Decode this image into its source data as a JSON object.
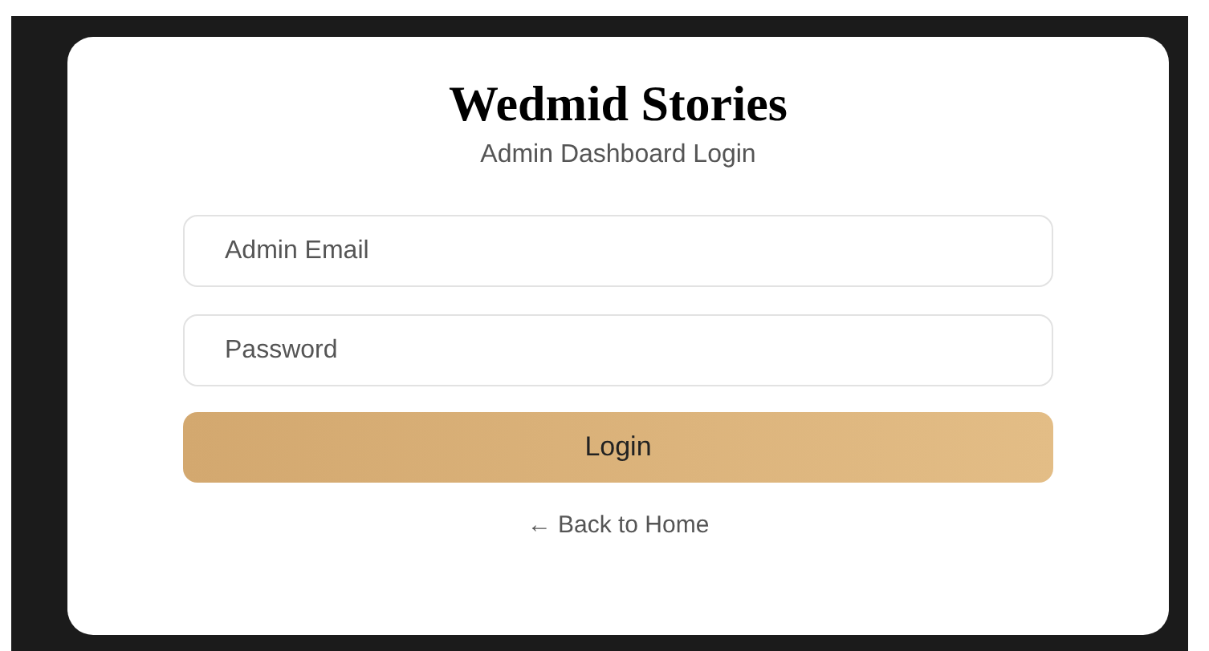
{
  "title": "Wedmid Stories",
  "subtitle": "Admin Dashboard Login",
  "fields": [
    {
      "placeholder": "Admin Email"
    },
    {
      "placeholder": "Password"
    }
  ],
  "button": "Login",
  "back_link": "← Back to Home"
}
